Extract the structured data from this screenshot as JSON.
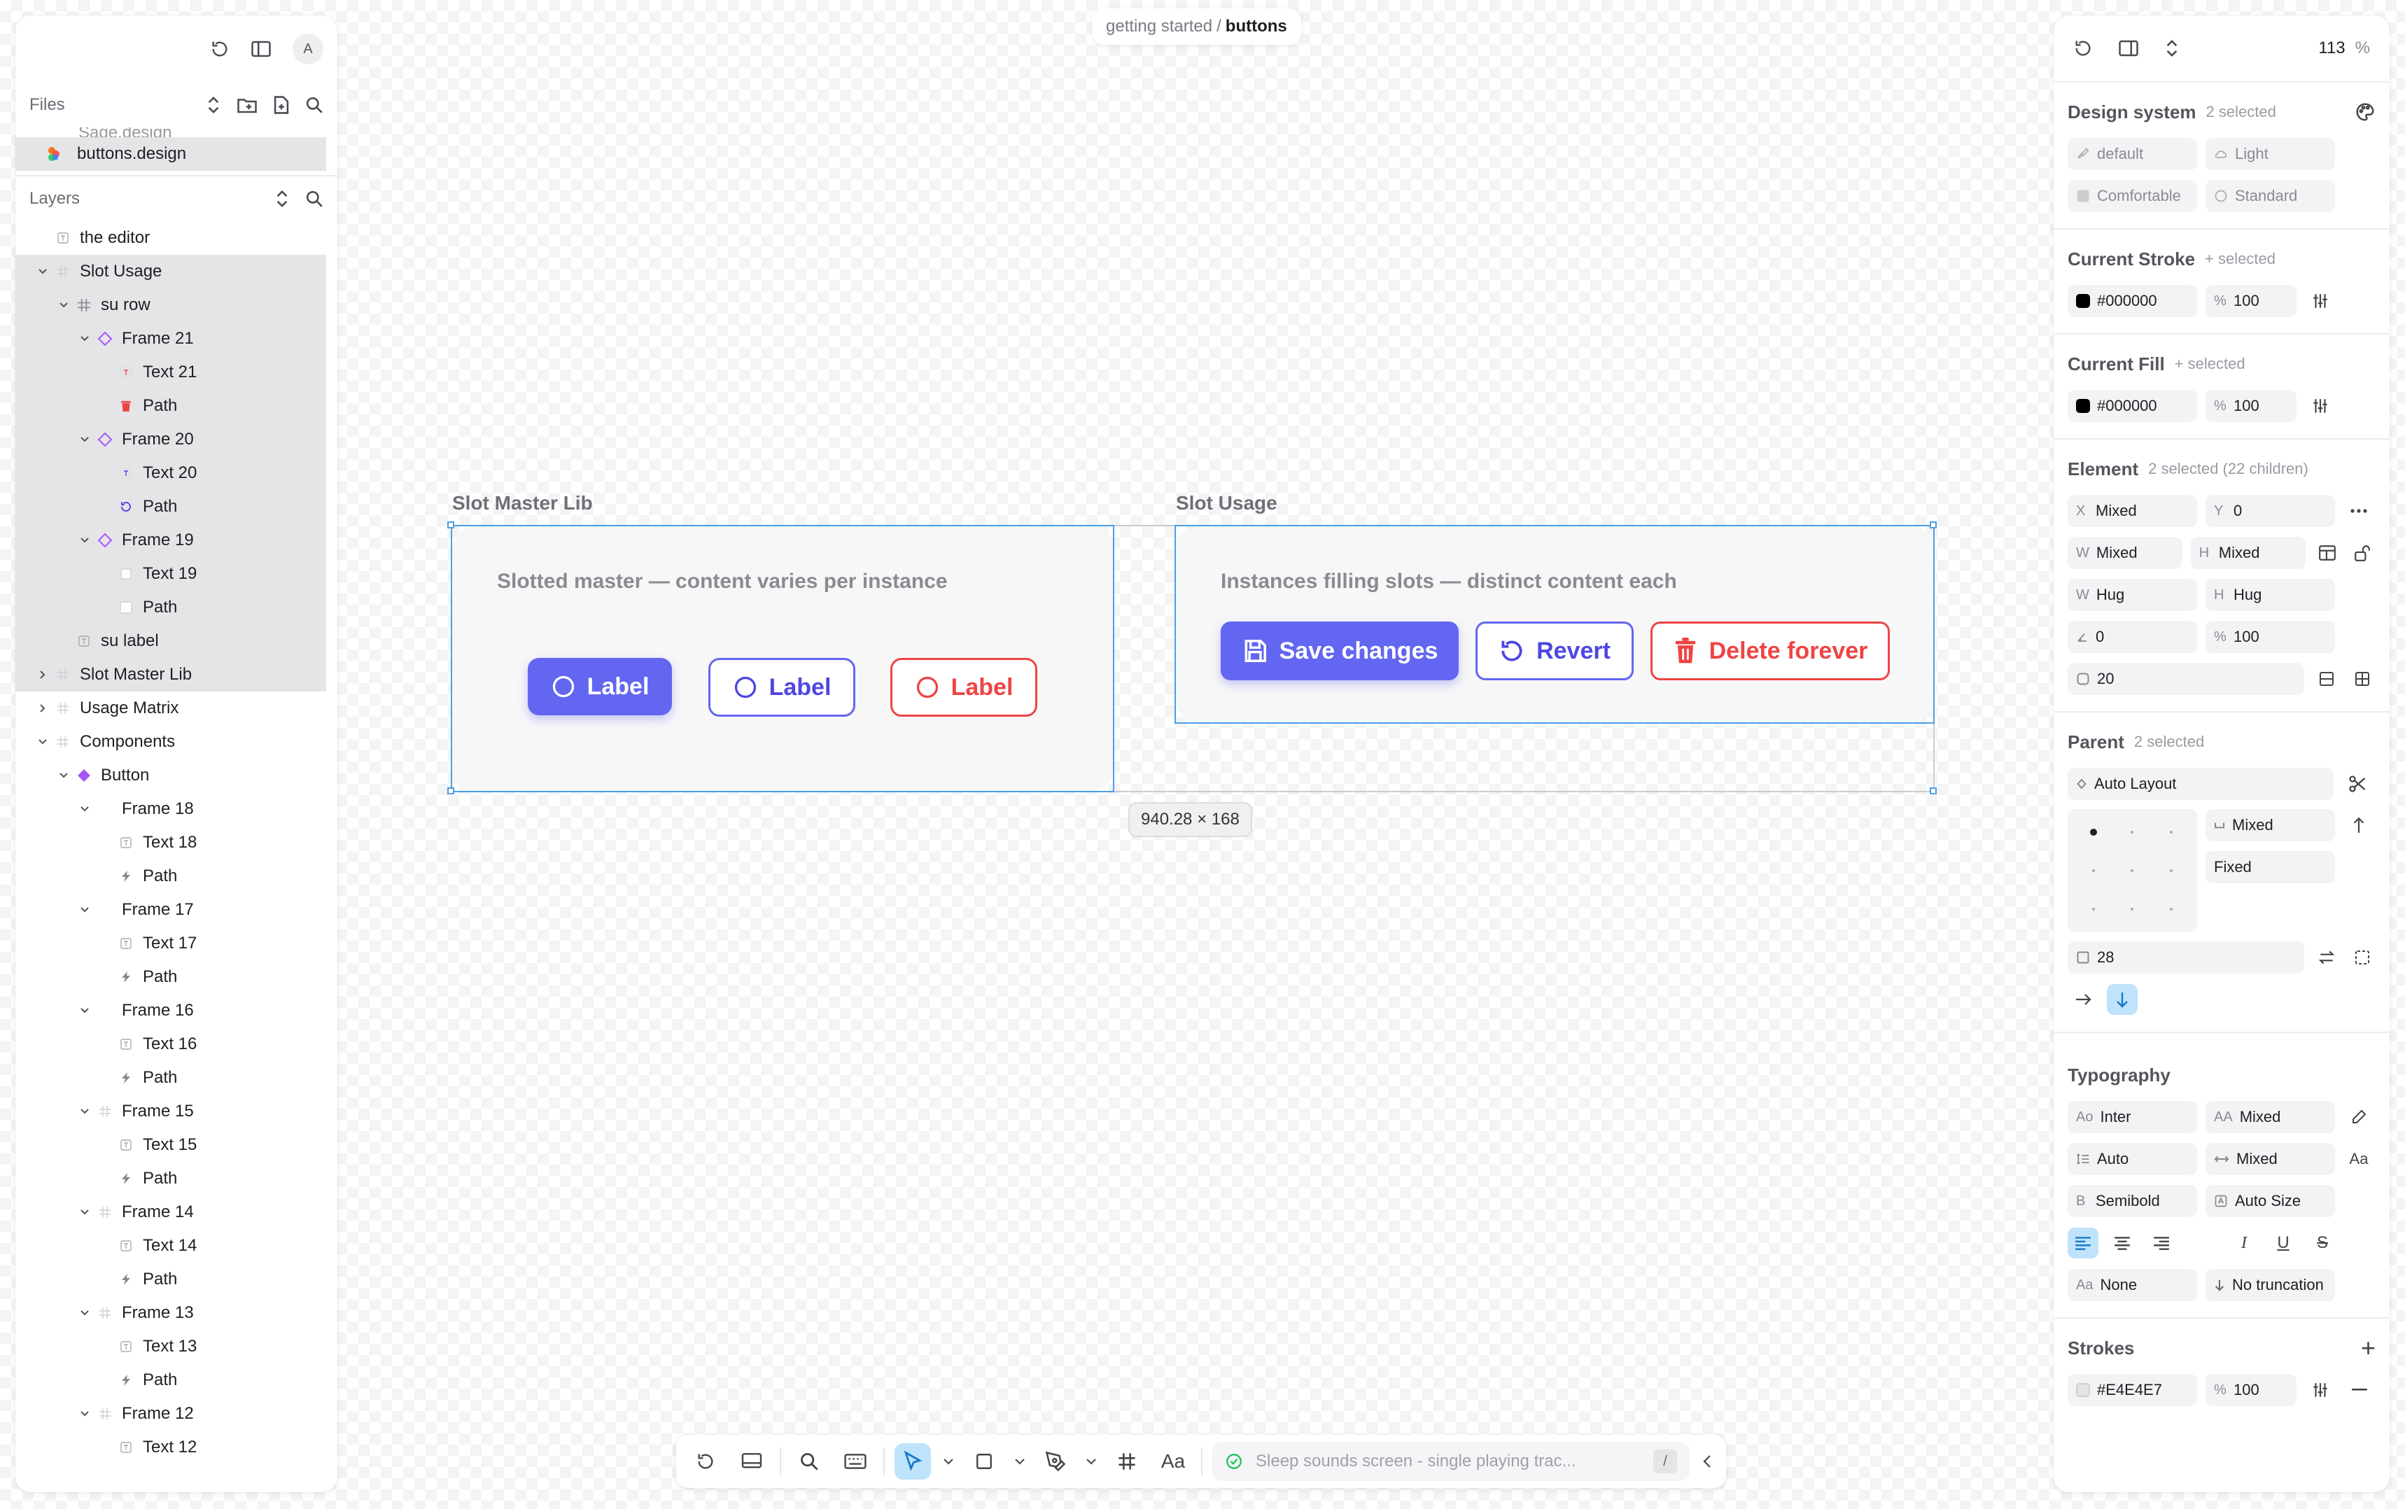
{
  "breadcrumb": {
    "parent": "getting started",
    "separator": "/",
    "current": "buttons"
  },
  "left": {
    "avatar": "A",
    "files": {
      "title": "Files",
      "ghost": "Sage.design",
      "active_file": "buttons.design"
    },
    "layers": {
      "title": "Layers",
      "items": [
        {
          "label": "the editor",
          "depth": 0,
          "chev": "none",
          "icon": "text",
          "selected": false
        },
        {
          "label": "Slot Usage",
          "depth": 0,
          "chev": "down",
          "icon": "frame",
          "selected": true
        },
        {
          "label": "su row",
          "depth": 1,
          "chev": "down",
          "icon": "hash",
          "selected": true
        },
        {
          "label": "Frame 21",
          "depth": 2,
          "chev": "down",
          "icon": "component",
          "selected": true
        },
        {
          "label": "Text 21",
          "depth": 3,
          "chev": "none",
          "icon": "text-red",
          "selected": true
        },
        {
          "label": "Path",
          "depth": 3,
          "chev": "none",
          "icon": "trash-red",
          "selected": true
        },
        {
          "label": "Frame 20",
          "depth": 2,
          "chev": "down",
          "icon": "component",
          "selected": true
        },
        {
          "label": "Text 20",
          "depth": 3,
          "chev": "none",
          "icon": "text-blue",
          "selected": true
        },
        {
          "label": "Path",
          "depth": 3,
          "chev": "none",
          "icon": "revert",
          "selected": true
        },
        {
          "label": "Frame 19",
          "depth": 2,
          "chev": "down",
          "icon": "component",
          "selected": true
        },
        {
          "label": "Text 19",
          "depth": 3,
          "chev": "none",
          "icon": "text-white",
          "selected": true
        },
        {
          "label": "Path",
          "depth": 3,
          "chev": "none",
          "icon": "square-white",
          "selected": true
        },
        {
          "label": "su label",
          "depth": 1,
          "chev": "none",
          "icon": "text",
          "selected": true
        },
        {
          "label": "Slot Master Lib",
          "depth": 0,
          "chev": "right",
          "icon": "frame",
          "selected": true
        },
        {
          "label": "Usage Matrix",
          "depth": 0,
          "chev": "right",
          "icon": "frame",
          "selected": false
        },
        {
          "label": "Components",
          "depth": 0,
          "chev": "down",
          "icon": "frame",
          "selected": false
        },
        {
          "label": "Button",
          "depth": 1,
          "chev": "down",
          "icon": "component-filled",
          "selected": false
        },
        {
          "label": "Frame 18",
          "depth": 2,
          "chev": "down",
          "icon": "none",
          "selected": false
        },
        {
          "label": "Text 18",
          "depth": 3,
          "chev": "none",
          "icon": "text",
          "selected": false
        },
        {
          "label": "Path",
          "depth": 3,
          "chev": "none",
          "icon": "bolt",
          "selected": false
        },
        {
          "label": "Frame 17",
          "depth": 2,
          "chev": "down",
          "icon": "none",
          "selected": false
        },
        {
          "label": "Text 17",
          "depth": 3,
          "chev": "none",
          "icon": "text",
          "selected": false
        },
        {
          "label": "Path",
          "depth": 3,
          "chev": "none",
          "icon": "bolt",
          "selected": false
        },
        {
          "label": "Frame 16",
          "depth": 2,
          "chev": "down",
          "icon": "none",
          "selected": false
        },
        {
          "label": "Text 16",
          "depth": 3,
          "chev": "none",
          "icon": "text",
          "selected": false
        },
        {
          "label": "Path",
          "depth": 3,
          "chev": "none",
          "icon": "bolt",
          "selected": false
        },
        {
          "label": "Frame 15",
          "depth": 2,
          "chev": "down",
          "icon": "frame",
          "selected": false
        },
        {
          "label": "Text 15",
          "depth": 3,
          "chev": "none",
          "icon": "text",
          "selected": false
        },
        {
          "label": "Path",
          "depth": 3,
          "chev": "none",
          "icon": "bolt",
          "selected": false
        },
        {
          "label": "Frame 14",
          "depth": 2,
          "chev": "down",
          "icon": "frame",
          "selected": false
        },
        {
          "label": "Text 14",
          "depth": 3,
          "chev": "none",
          "icon": "text",
          "selected": false
        },
        {
          "label": "Path",
          "depth": 3,
          "chev": "none",
          "icon": "bolt",
          "selected": false
        },
        {
          "label": "Frame 13",
          "depth": 2,
          "chev": "down",
          "icon": "frame",
          "selected": false
        },
        {
          "label": "Text 13",
          "depth": 3,
          "chev": "none",
          "icon": "text",
          "selected": false
        },
        {
          "label": "Path",
          "depth": 3,
          "chev": "none",
          "icon": "bolt",
          "selected": false
        },
        {
          "label": "Frame 12",
          "depth": 2,
          "chev": "down",
          "icon": "frame",
          "selected": false
        },
        {
          "label": "Text 12",
          "depth": 3,
          "chev": "none",
          "icon": "text",
          "selected": false
        }
      ]
    }
  },
  "canvas": {
    "master": {
      "label": "Slot Master Lib",
      "subtitle": "Slotted master — content varies per instance",
      "buttons": [
        "Label",
        "Label",
        "Label"
      ]
    },
    "usage": {
      "label": "Slot Usage",
      "subtitle": "Instances filling slots — distinct content each",
      "save": "Save changes",
      "revert": "Revert",
      "delete": "Delete forever"
    },
    "dimensions": "940.28 × 168"
  },
  "right": {
    "zoom": "113",
    "zoom_unit": "%",
    "design_system": {
      "title": "Design system",
      "sub": "2 selected",
      "fields": [
        "default",
        "Light",
        "Comfortable",
        "Standard"
      ]
    },
    "stroke": {
      "title": "Current Stroke",
      "sub": "+ selected",
      "color": "#000000",
      "opacity_label": "%",
      "opacity": "100"
    },
    "fill": {
      "title": "Current Fill",
      "sub": "+ selected",
      "color": "#000000",
      "opacity_label": "%",
      "opacity": "100"
    },
    "element": {
      "title": "Element",
      "sub": "2 selected (22 children)",
      "x_label": "X",
      "x": "Mixed",
      "y_label": "Y",
      "y": "0",
      "w_label": "W",
      "w": "Mixed",
      "h_label": "H",
      "h": "Mixed",
      "w2_label": "W",
      "w2": "Hug",
      "h2_label": "H",
      "h2": "Hug",
      "rotation": "0",
      "opacity_label": "%",
      "opacity": "100",
      "radius": "20"
    },
    "parent": {
      "title": "Parent",
      "sub": "2 selected",
      "layout": "Auto Layout",
      "gap": "Mixed",
      "sizing": "Fixed",
      "padding": "28"
    },
    "typography": {
      "title": "Typography",
      "font_pre": "Ao",
      "font": "Inter",
      "size_pre": "AA",
      "size": "Mixed",
      "line": "Auto",
      "spacing": "Mixed",
      "weight_pre": "B",
      "weight": "Semibold",
      "autosize": "Auto Size",
      "case_pre": "Aa",
      "case": "None",
      "truncation": "No truncation",
      "aa_label": "Aa"
    },
    "strokes": {
      "title": "Strokes",
      "color": "#E4E4E7",
      "opacity_label": "%",
      "opacity": "100"
    }
  },
  "toolbar": {
    "text_tool": "Aa",
    "status": "Sleep sounds screen - single playing trac...",
    "shortcut": "/"
  },
  "colors": {
    "accent": "#6366f1",
    "danger": "#ef4444",
    "selection": "#4a9fe8"
  }
}
